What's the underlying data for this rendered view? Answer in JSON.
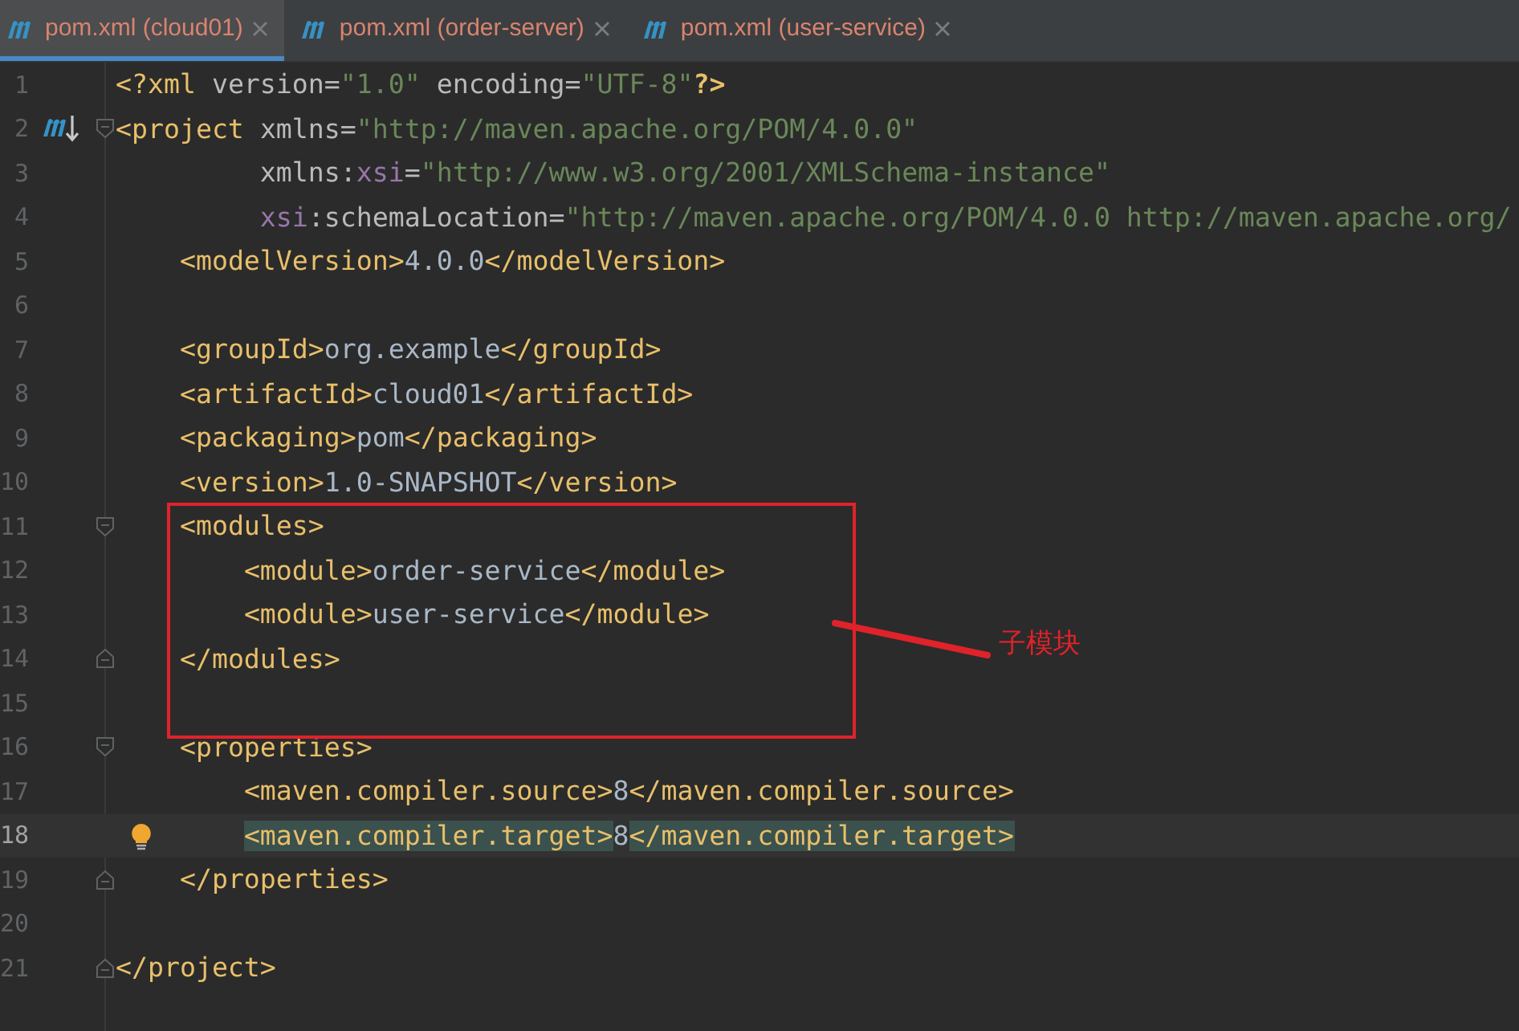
{
  "tabs": [
    {
      "label": "pom.xml (cloud01)",
      "selected": true
    },
    {
      "label": "pom.xml (order-server)",
      "selected": false
    },
    {
      "label": "pom.xml (user-service)",
      "selected": false
    }
  ],
  "editor": {
    "lines": [
      {
        "number": "1",
        "current": false,
        "tokens": [
          {
            "kind": "tag",
            "text": "<?xml"
          },
          {
            "kind": "attr",
            "text": " version="
          },
          {
            "kind": "string",
            "text": "\"1.0\""
          },
          {
            "kind": "attr",
            "text": " encoding="
          },
          {
            "kind": "string",
            "text": "\"UTF-8\""
          },
          {
            "kind": "pi_end",
            "text": "?>"
          }
        ]
      },
      {
        "number": "2",
        "current": false,
        "maven_marker": true,
        "fold_start": true,
        "tokens": [
          {
            "kind": "tag",
            "text": "<project"
          },
          {
            "kind": "attr",
            "text": " xmlns="
          },
          {
            "kind": "string",
            "text": "\"http://maven.apache.org/POM/4.0.0\""
          }
        ]
      },
      {
        "number": "3",
        "current": false,
        "tokens": [
          {
            "kind": "attr",
            "text": "         xmlns:"
          },
          {
            "kind": "ns",
            "text": "xsi"
          },
          {
            "kind": "attr",
            "text": "="
          },
          {
            "kind": "string",
            "text": "\"http://www.w3.org/2001/XMLSchema-instance\""
          }
        ]
      },
      {
        "number": "4",
        "current": false,
        "tokens": [
          {
            "kind": "ns",
            "text": "         xsi"
          },
          {
            "kind": "attr",
            "text": ":schemaLocation="
          },
          {
            "kind": "string",
            "text": "\"http://maven.apache.org/POM/4.0.0 http://maven.apache.org/"
          }
        ]
      },
      {
        "number": "5",
        "current": false,
        "tokens": [
          {
            "kind": "tag",
            "text": "    <modelVersion>"
          },
          {
            "kind": "text",
            "text": "4.0.0"
          },
          {
            "kind": "tag",
            "text": "</modelVersion>"
          }
        ]
      },
      {
        "number": "6",
        "current": false
      },
      {
        "number": "7",
        "current": false,
        "tokens": [
          {
            "kind": "tag",
            "text": "    <groupId>"
          },
          {
            "kind": "text",
            "text": "org.example"
          },
          {
            "kind": "tag",
            "text": "</groupId>"
          }
        ]
      },
      {
        "number": "8",
        "current": false,
        "tokens": [
          {
            "kind": "tag",
            "text": "    <artifactId>"
          },
          {
            "kind": "text",
            "text": "cloud01"
          },
          {
            "kind": "tag",
            "text": "</artifactId>"
          }
        ]
      },
      {
        "number": "9",
        "current": false,
        "tokens": [
          {
            "kind": "tag",
            "text": "    <packaging>"
          },
          {
            "kind": "text",
            "text": "pom"
          },
          {
            "kind": "tag",
            "text": "</packaging>"
          }
        ]
      },
      {
        "number": "10",
        "current": false,
        "tokens": [
          {
            "kind": "tag",
            "text": "    <version>"
          },
          {
            "kind": "text",
            "text": "1.0-SNAPSHOT"
          },
          {
            "kind": "tag",
            "text": "</version>"
          }
        ]
      },
      {
        "number": "11",
        "current": false,
        "fold_start": true,
        "tokens": [
          {
            "kind": "tag",
            "text": "    <modules>"
          }
        ]
      },
      {
        "number": "12",
        "current": false,
        "tokens": [
          {
            "kind": "tag",
            "text": "        <module>"
          },
          {
            "kind": "text",
            "text": "order-service"
          },
          {
            "kind": "tag",
            "text": "</module>"
          }
        ]
      },
      {
        "number": "13",
        "current": false,
        "tokens": [
          {
            "kind": "tag",
            "text": "        <module>"
          },
          {
            "kind": "text",
            "text": "user-service"
          },
          {
            "kind": "tag",
            "text": "</module>"
          }
        ]
      },
      {
        "number": "14",
        "current": false,
        "fold_end": true,
        "tokens": [
          {
            "kind": "tag",
            "text": "    </modules>"
          }
        ]
      },
      {
        "number": "15",
        "current": false
      },
      {
        "number": "16",
        "current": false,
        "fold_start": true,
        "tokens": [
          {
            "kind": "tag",
            "text": "    <properties>"
          }
        ]
      },
      {
        "number": "17",
        "current": false,
        "tokens": [
          {
            "kind": "tag",
            "text": "        <maven.compiler.source>"
          },
          {
            "kind": "text",
            "text": "8"
          },
          {
            "kind": "tag",
            "text": "</maven.compiler.source>"
          }
        ]
      },
      {
        "number": "18",
        "current": true,
        "intention_bulb": true,
        "tokens": [
          {
            "kind": "match",
            "text": "        <maven.compiler.target>"
          },
          {
            "kind": "text",
            "text": "8"
          },
          {
            "kind": "match",
            "text": "</maven.compiler.target>"
          }
        ]
      },
      {
        "number": "19",
        "current": false,
        "fold_end": true,
        "tokens": [
          {
            "kind": "tag",
            "text": "    </properties>"
          }
        ]
      },
      {
        "number": "20",
        "current": false
      },
      {
        "number": "21",
        "current": false,
        "fold_end": true,
        "tokens": [
          {
            "kind": "tag",
            "text": "</project>"
          }
        ]
      }
    ]
  },
  "annotation": {
    "label": "子模块"
  }
}
